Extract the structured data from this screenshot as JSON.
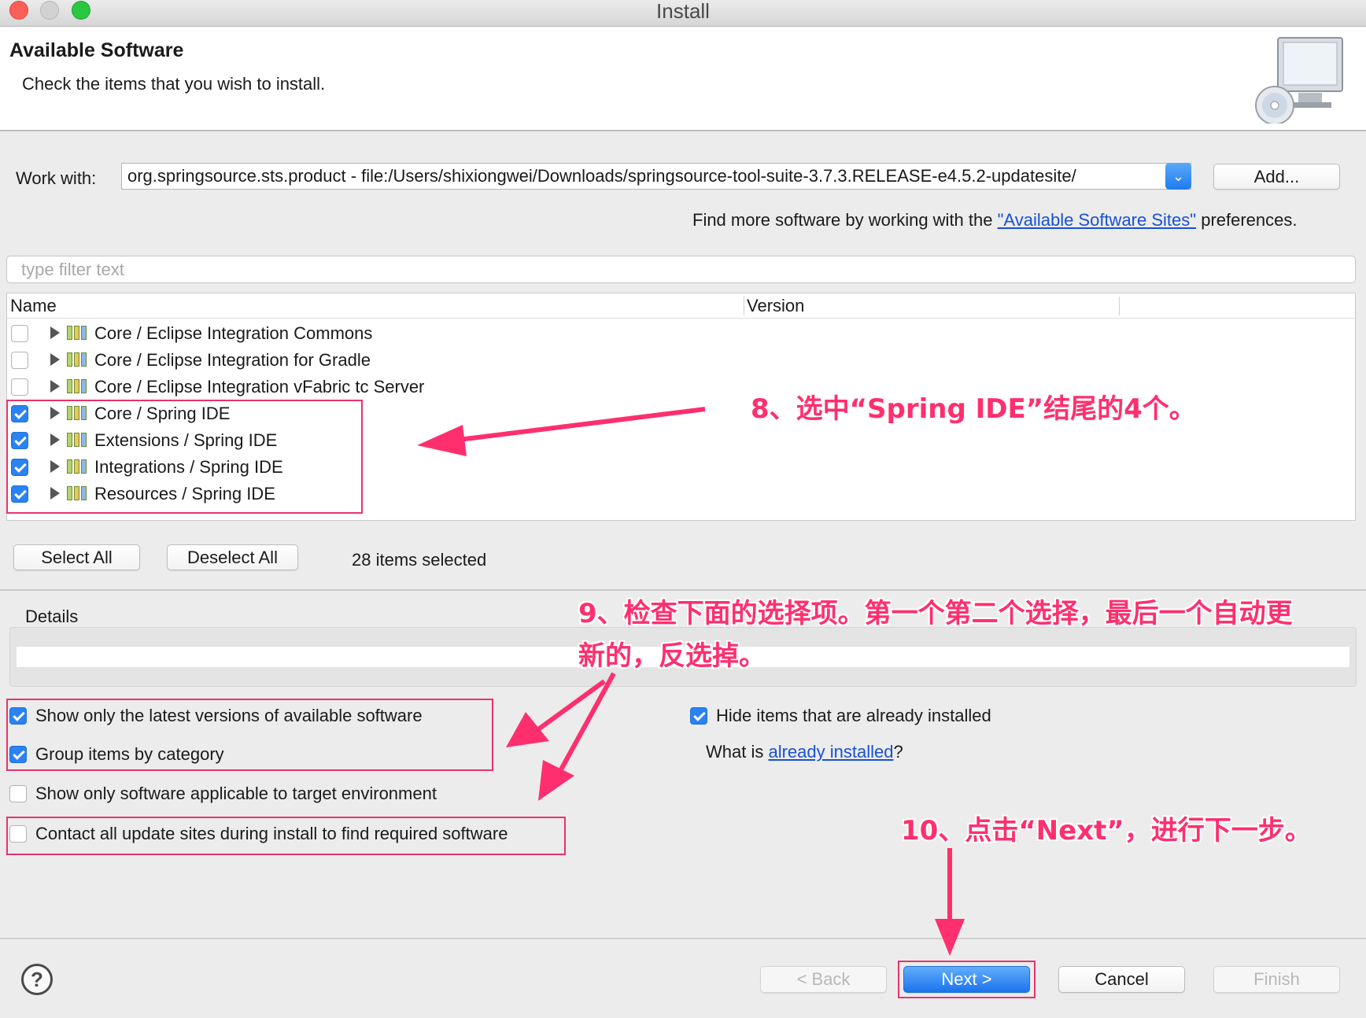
{
  "window": {
    "title": "Install"
  },
  "header": {
    "title": "Available Software",
    "subtitle": "Check the items that you wish to install."
  },
  "work_with": {
    "label": "Work with:",
    "value": "org.springsource.sts.product - file:/Users/shixiongwei/Downloads/springsource-tool-suite-3.7.3.RELEASE-e4.5.2-updatesite/",
    "add_label": "Add...",
    "hint_prefix": "Find more software by working with the",
    "hint_link": "\"Available Software Sites\"",
    "hint_suffix": "preferences."
  },
  "filter": {
    "placeholder": "type filter text"
  },
  "tree": {
    "col_name": "Name",
    "col_version": "Version",
    "rows": [
      {
        "label": "Core / Eclipse Integration Commons",
        "checked": false
      },
      {
        "label": "Core / Eclipse Integration for Gradle",
        "checked": false
      },
      {
        "label": "Core / Eclipse Integration vFabric tc Server",
        "checked": false
      },
      {
        "label": "Core / Spring IDE",
        "checked": true
      },
      {
        "label": "Extensions / Spring IDE",
        "checked": true
      },
      {
        "label": "Integrations / Spring IDE",
        "checked": true
      },
      {
        "label": "Resources / Spring IDE",
        "checked": true
      }
    ]
  },
  "selection": {
    "select_all": "Select All",
    "deselect_all": "Deselect All",
    "status": "28 items selected"
  },
  "details": {
    "label": "Details"
  },
  "options": {
    "latest_versions": {
      "label": "Show only the latest versions of available software",
      "checked": true
    },
    "group_by_category": {
      "label": "Group items by category",
      "checked": true
    },
    "applicable_target": {
      "label": "Show only software applicable to target environment",
      "checked": false
    },
    "contact_sites": {
      "label": "Contact all update sites during install to find required software",
      "checked": false
    },
    "hide_installed": {
      "label": "Hide items that are already installed",
      "checked": true
    },
    "what_is_prefix": "What is",
    "what_is_link": "already installed",
    "what_is_suffix": "?"
  },
  "footer": {
    "help": "?",
    "back": "< Back",
    "next": "Next >",
    "cancel": "Cancel",
    "finish": "Finish"
  },
  "annotations": {
    "step8": "8、选中“Spring IDE”结尾的4个。",
    "step9_line1": "9、检查下面的选择项。第一个第二个选择，最后一个自动更",
    "step9_line2": "新的，反选掉。",
    "step10": "10、点击“Next”，进行下一步。",
    "color": "#ff2f6e"
  }
}
